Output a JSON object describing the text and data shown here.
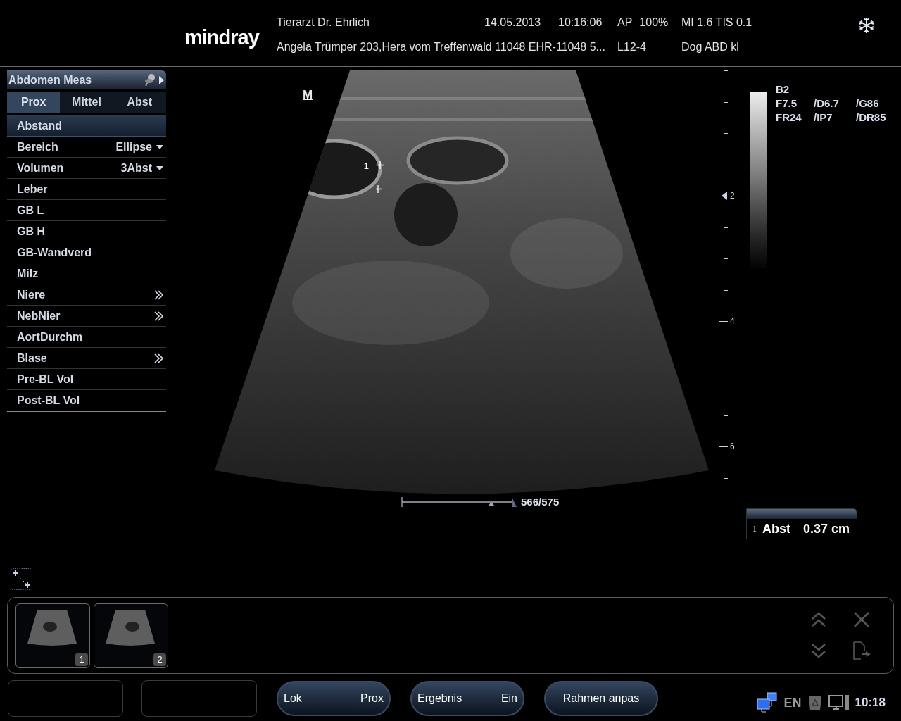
{
  "header": {
    "logo": "mindray",
    "institution": "Tierarzt Dr. Ehrlich",
    "date": "14.05.2013",
    "time": "10:16:06",
    "power_label": "AP",
    "power_value": "100%",
    "indices": "MI 1.6 TIS 0.1",
    "patient": "Angela Trümper 203,Hera vom Treffenwald 11048 EHR-11048 5...",
    "probe": "L12-4",
    "exam": "Dog ABD kl"
  },
  "meas_panel": {
    "title": "Abdomen Meas",
    "tabs": [
      {
        "label": "Prox",
        "selected": true
      },
      {
        "label": "Mittel",
        "selected": false
      },
      {
        "label": "Abst",
        "selected": false
      }
    ],
    "items": [
      {
        "label": "Abstand",
        "kind": "plain",
        "selected": true
      },
      {
        "label": "Bereich",
        "kind": "dropdown",
        "value": "Ellipse",
        "selected": false
      },
      {
        "label": "Volumen",
        "kind": "dropdown",
        "value": "3Abst",
        "selected": false
      },
      {
        "label": "Leber",
        "kind": "plain",
        "selected": false
      },
      {
        "label": "GB L",
        "kind": "plain",
        "selected": false
      },
      {
        "label": "GB H",
        "kind": "plain",
        "selected": false
      },
      {
        "label": "GB-Wandverd",
        "kind": "plain",
        "selected": false
      },
      {
        "label": "Milz",
        "kind": "plain",
        "selected": false
      },
      {
        "label": "Niere",
        "kind": "submenu",
        "selected": false
      },
      {
        "label": "NebNier",
        "kind": "submenu",
        "selected": false
      },
      {
        "label": "AortDurchm",
        "kind": "plain",
        "selected": false
      },
      {
        "label": "Blase",
        "kind": "submenu",
        "selected": false
      },
      {
        "label": "Pre-BL Vol",
        "kind": "plain",
        "selected": false
      },
      {
        "label": "Post-BL Vol",
        "kind": "plain",
        "selected": false
      }
    ]
  },
  "image": {
    "orientation_mark": "M",
    "caliper_label": "1",
    "scale_reading": "566/575",
    "depth_labels": [
      {
        "text": "2",
        "focus": true
      },
      {
        "text": "4",
        "focus": false
      },
      {
        "text": "6",
        "focus": false
      }
    ]
  },
  "params": {
    "mode": "B2",
    "rows": [
      [
        "F7.5",
        "/D6.7",
        "/G86"
      ],
      [
        "FR24",
        "/IP7",
        "/DR85"
      ]
    ]
  },
  "result": {
    "index": "1",
    "label": "Abst",
    "value": "0.37 cm"
  },
  "thumbnails": [
    {
      "number": "1"
    },
    {
      "number": "2"
    }
  ],
  "bottom_buttons": [
    {
      "kind": "empty"
    },
    {
      "kind": "empty"
    },
    {
      "kind": "pair",
      "left": "Lok",
      "right": "Prox"
    },
    {
      "kind": "pair",
      "left": "Ergebnis",
      "right": "Ein"
    },
    {
      "kind": "single",
      "label": "Rahmen anpas"
    }
  ],
  "tray": {
    "language": "EN",
    "clock": "10:18"
  }
}
